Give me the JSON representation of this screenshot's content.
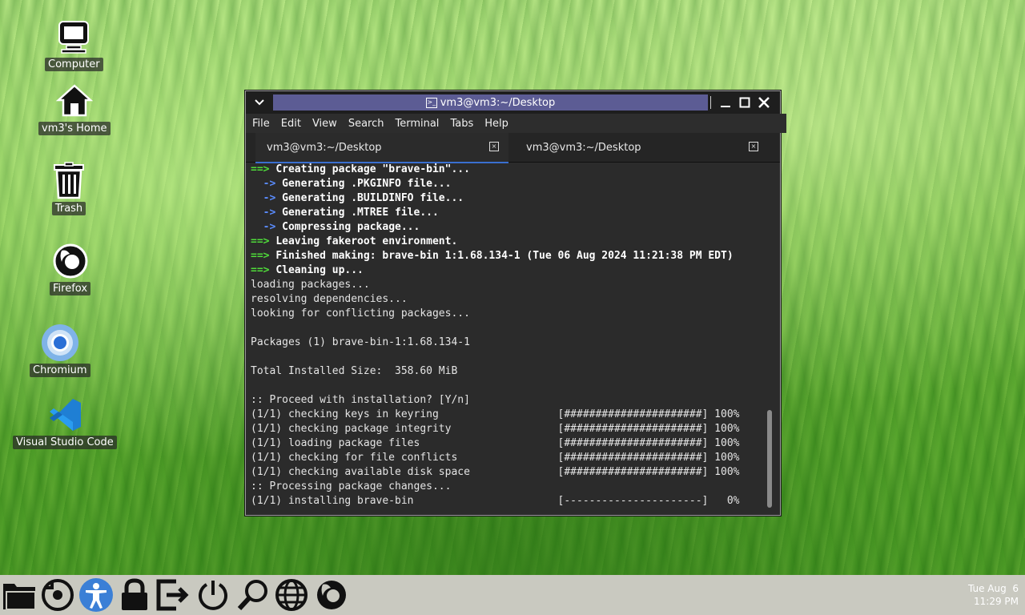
{
  "desktop": {
    "icons": [
      {
        "label": "Computer",
        "icon": "computer-icon"
      },
      {
        "label": "vm3's Home",
        "icon": "home-icon"
      },
      {
        "label": "Trash",
        "icon": "trash-icon"
      },
      {
        "label": "Firefox",
        "icon": "firefox-icon"
      },
      {
        "label": "Chromium",
        "icon": "chromium-icon"
      },
      {
        "label": "Visual Studio Code",
        "icon": "vscode-icon"
      }
    ]
  },
  "window": {
    "title": "vm3@vm3:~/Desktop",
    "menu": [
      "File",
      "Edit",
      "View",
      "Search",
      "Terminal",
      "Tabs",
      "Help"
    ],
    "tabs": [
      {
        "label": "vm3@vm3:~/Desktop",
        "active": true
      },
      {
        "label": "vm3@vm3:~/Desktop",
        "active": false
      }
    ]
  },
  "terminal": {
    "lines": [
      {
        "prefix": "==> ",
        "prefix_type": "green",
        "text": "Creating package \"brave-bin\"...",
        "bold": true
      },
      {
        "prefix": "  -> ",
        "prefix_type": "blue",
        "text": "Generating .PKGINFO file...",
        "bold": true
      },
      {
        "prefix": "  -> ",
        "prefix_type": "blue",
        "text": "Generating .BUILDINFO file...",
        "bold": true
      },
      {
        "prefix": "  -> ",
        "prefix_type": "blue",
        "text": "Generating .MTREE file...",
        "bold": true
      },
      {
        "prefix": "  -> ",
        "prefix_type": "blue",
        "text": "Compressing package...",
        "bold": true
      },
      {
        "prefix": "==> ",
        "prefix_type": "green",
        "text": "Leaving fakeroot environment.",
        "bold": true
      },
      {
        "prefix": "==> ",
        "prefix_type": "green",
        "text": "Finished making: brave-bin 1:1.68.134-1 (Tue 06 Aug 2024 11:21:38 PM EDT)",
        "bold": true
      },
      {
        "prefix": "==> ",
        "prefix_type": "green",
        "text": "Cleaning up...",
        "bold": true
      },
      {
        "prefix": "",
        "prefix_type": "none",
        "text": "loading packages...",
        "bold": false
      },
      {
        "prefix": "",
        "prefix_type": "none",
        "text": "resolving dependencies...",
        "bold": false
      },
      {
        "prefix": "",
        "prefix_type": "none",
        "text": "looking for conflicting packages...",
        "bold": false
      },
      {
        "prefix": "",
        "prefix_type": "none",
        "text": "",
        "bold": false
      },
      {
        "prefix": "",
        "prefix_type": "none",
        "text": "Packages (1) brave-bin-1:1.68.134-1",
        "bold": false
      },
      {
        "prefix": "",
        "prefix_type": "none",
        "text": "",
        "bold": false
      },
      {
        "prefix": "",
        "prefix_type": "none",
        "text": "Total Installed Size:  358.60 MiB",
        "bold": false
      },
      {
        "prefix": "",
        "prefix_type": "none",
        "text": "",
        "bold": false
      },
      {
        "prefix": "",
        "prefix_type": "none",
        "text": ":: Proceed with installation? [Y/n]",
        "bold": false
      },
      {
        "prefix": "",
        "prefix_type": "none",
        "text": "(1/1) checking keys in keyring                   [######################] 100%",
        "bold": false
      },
      {
        "prefix": "",
        "prefix_type": "none",
        "text": "(1/1) checking package integrity                 [######################] 100%",
        "bold": false
      },
      {
        "prefix": "",
        "prefix_type": "none",
        "text": "(1/1) loading package files                      [######################] 100%",
        "bold": false
      },
      {
        "prefix": "",
        "prefix_type": "none",
        "text": "(1/1) checking for file conflicts                [######################] 100%",
        "bold": false
      },
      {
        "prefix": "",
        "prefix_type": "none",
        "text": "(1/1) checking available disk space              [######################] 100%",
        "bold": false
      },
      {
        "prefix": "",
        "prefix_type": "none",
        "text": ":: Processing package changes...",
        "bold": false
      },
      {
        "prefix": "",
        "prefix_type": "none",
        "text": "(1/1) installing brave-bin                       [----------------------]   0%",
        "bold": false
      }
    ]
  },
  "taskbar": {
    "items": [
      "file-manager-icon",
      "restart-icon",
      "accessibility-icon",
      "lock-icon",
      "logout-icon",
      "power-icon",
      "search-icon",
      "web-browser-icon",
      "firefox-icon"
    ],
    "clock_date": "Tue Aug  6",
    "clock_time": "11:29 PM"
  },
  "colors": {
    "accent": "#5c5c94",
    "prompt_green": "#4fdc3a",
    "prompt_blue": "#5a8cff",
    "tab_underline": "#3a6fd0"
  }
}
